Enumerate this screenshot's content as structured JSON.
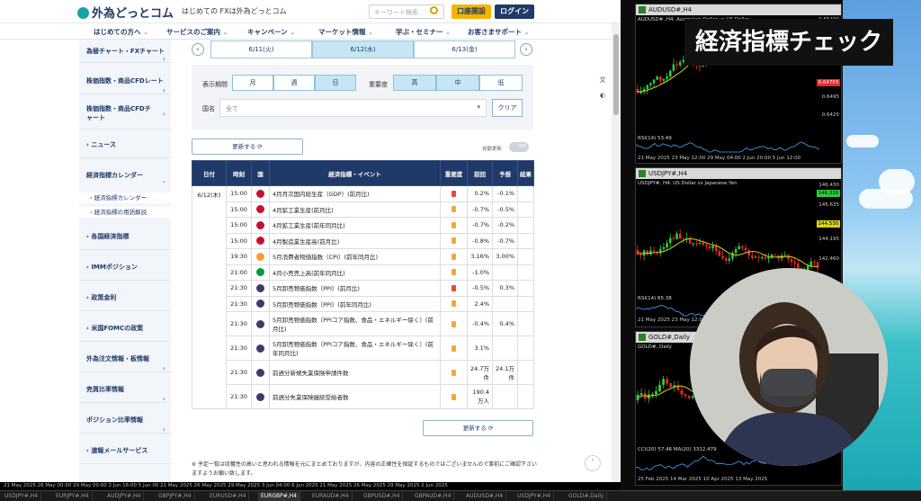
{
  "site": {
    "logo": "外為どっとコム",
    "tagline": "はじめての FXは外為どっとコム",
    "search_placeholder": "キーワード検索",
    "open_account": "口座開設",
    "login": "ログイン"
  },
  "nav": [
    "はじめての方へ",
    "サービスのご案内",
    "キャンペーン",
    "マーケット情報",
    "学ぶ・セミナー",
    "お客さまサポート"
  ],
  "sidebar": [
    "為替チャート・FXチャート",
    "株価指数・商品CFDレート",
    "株価指数・商品CFDチャート",
    "ニュース",
    "経済指標カレンダー",
    "各国経済指標",
    "IMMポジション",
    "政策金利",
    "米国FOMCの政策",
    "外為注文情報・板情報",
    "売買比率情報",
    "ポジション比率情報",
    "速報メールサービス"
  ],
  "sidebar_sub": [
    "経済指標カレンダー",
    "経済指標の用語解説"
  ],
  "date_tabs": [
    "6/11(火)",
    "6/12(水)",
    "6/13(金)"
  ],
  "filter": {
    "period_label": "表示期間",
    "period_options": [
      "月",
      "週",
      "日"
    ],
    "importance_label": "重要度",
    "importance_options": [
      "高",
      "中",
      "低"
    ],
    "country_label": "国名",
    "country_value": "全て",
    "clear": "クリア"
  },
  "update_button": "更新する ⟳",
  "auto_update_label": "自動更新",
  "toggle_state": "OFF",
  "table": {
    "headers": [
      "日付",
      "時刻",
      "国",
      "経済指標・イベント",
      "重要度",
      "前回",
      "予想",
      "結果"
    ],
    "date": "6/12(木)",
    "rows": [
      {
        "time": "15:00",
        "country": "UK",
        "event": "4月月次国内総生産（GDP）(前月比)",
        "imp": "high",
        "prev": "0.2%",
        "fcst": "-0.1%"
      },
      {
        "time": "15:00",
        "country": "UK",
        "event": "4月鉱工業生産(前月比)",
        "imp": "mid",
        "prev": "-0.7%",
        "fcst": "-0.5%"
      },
      {
        "time": "15:00",
        "country": "UK",
        "event": "4月鉱工業生産(前年同月比)",
        "imp": "mid",
        "prev": "-0.7%",
        "fcst": "-0.2%"
      },
      {
        "time": "15:00",
        "country": "UK",
        "event": "4月製造業生産高(前月比)",
        "imp": "mid",
        "prev": "-0.8%",
        "fcst": "-0.7%"
      },
      {
        "time": "19:30",
        "country": "IN",
        "event": "5月消費者物価指数（CPI）(前年同月比)",
        "imp": "mid",
        "prev": "3.16%",
        "fcst": "3.00%"
      },
      {
        "time": "21:00",
        "country": "BR",
        "event": "4月小売売上高(前年同月比)",
        "imp": "mid",
        "prev": "-1.0%",
        "fcst": ""
      },
      {
        "time": "21:30",
        "country": "US",
        "event": "5月卸売物価指数（PPI）(前月比)",
        "imp": "high",
        "prev": "-0.5%",
        "fcst": "0.3%"
      },
      {
        "time": "21:30",
        "country": "US",
        "event": "5月卸売物価指数（PPI）(前年同月比)",
        "imp": "mid",
        "prev": "2.4%",
        "fcst": ""
      },
      {
        "time": "21:30",
        "country": "US",
        "event": "5月卸売物価指数（PPIコア指数、食品・エネルギー除く）(前月比)",
        "imp": "mid",
        "prev": "-0.4%",
        "fcst": "0.4%",
        "tall": true
      },
      {
        "time": "21:30",
        "country": "US",
        "event": "5月卸売物価指数（PPIコア指数、食品・エネルギー除く）(前年同月比)",
        "imp": "mid",
        "prev": "3.1%",
        "fcst": "",
        "tall": true
      },
      {
        "time": "21:30",
        "country": "US",
        "event": "前週分新規失業保険申請件数",
        "imp": "mid",
        "prev": "24.7万件",
        "fcst": "24.1万件",
        "tall": true
      },
      {
        "time": "21:30",
        "country": "US",
        "event": "前週分失業保険継続受給者数",
        "imp": "mid",
        "prev": "190.4万人",
        "fcst": "",
        "tall": true
      }
    ]
  },
  "footnote": "※ 予定一覧は収穫性の高いと思われる情報を元にまとめておりますが、内容の正確性を保証するものではございませんので事前にご確認下さいますようお願い致します。",
  "overlay_title": "経済指標チェック",
  "charts": [
    {
      "title": "AUDUSD#,H4",
      "sub": "AUDUSD#, H4: Australian Dollar vs US Dollar",
      "prices": [
        "0.65400",
        "0.6495",
        "0.6425",
        "0.6355"
      ],
      "price_tag": "0.64703",
      "indicator": "RSI(14) 53.49",
      "times": "21 May 2025   23 May 12:00   29 May 04:00   2 Jun 20:00   5 Jun 12:00"
    },
    {
      "title": "USDJPY#,H4",
      "sub": "USDJPY#, H4: US Dollar vs Japanese Yen",
      "prices": [
        "146.430",
        "146.320",
        "145.635",
        "144.195",
        "142.460"
      ],
      "price_tag": "144.530",
      "indicator": "RSI(14) 65.38",
      "times": "21 May 2025   23 May 12:00   29 May 04:00   2 Jun 20:00   5 Jun 12:00"
    },
    {
      "title": "GOLD#,Daily",
      "sub": "GOLD#, Daily",
      "prices": [],
      "price_tag": "",
      "indicator": "CCI(20) 57.46  MA(20) 3312.479",
      "times": "25 Feb 2025   14 Mar 2025   10 Apr 2025   13 May 2025"
    }
  ],
  "bottom_axis": "21 May 2025   26 May 00:00   29 May 00:00   2 Jun 16:00   5 Jun 00   21 May 2025   26 May 2025   29 May 2025   3 Jun 04:00   6 Jun 2025   21 May 2025   26 May 2025   29 May 2025   2 Jun 2025",
  "taskbar_tabs": [
    "USDJPY#,H4",
    "EURJPY#,H4",
    "AUDJPY#,H4",
    "GBPJPY#,H4",
    "EURUSD#,H4",
    "EURGBP#,H4",
    "EURAUD#,H4",
    "GBPUSD#,H4",
    "GBPAUD#,H4",
    "AUDUSD#,H4",
    "USDJPY#,H4",
    "GOLD#,Daily"
  ],
  "colors": {
    "navy": "#1f3a68",
    "tab_active": "#c6e6f3",
    "bull": "#2ecc40",
    "bear": "#e8262d",
    "ma_yellow": "#d6d21a"
  }
}
